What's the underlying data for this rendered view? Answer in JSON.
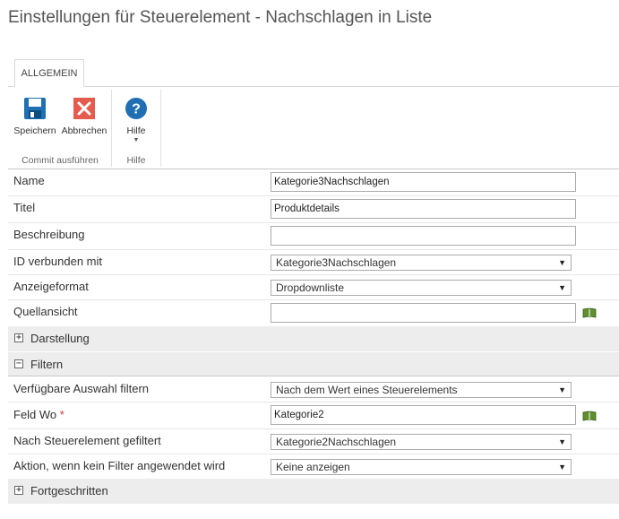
{
  "page": {
    "title": "Einstellungen für Steuerelement - Nachschlagen in Liste"
  },
  "ribbon": {
    "tab_label": "ALLGEMEIN",
    "buttons": {
      "save": "Speichern",
      "cancel": "Abbrechen",
      "help": "Hilfe"
    },
    "groups": {
      "commit": "Commit ausführen",
      "help": "Hilfe"
    }
  },
  "form": {
    "name_label": "Name",
    "name_value": "Kategorie3Nachschlagen",
    "titel_label": "Titel",
    "titel_value": "Produktdetails",
    "beschreibung_label": "Beschreibung",
    "beschreibung_value": "",
    "id_label": "ID verbunden mit",
    "id_value": "Kategorie3Nachschlagen",
    "anzeige_label": "Anzeigeformat",
    "anzeige_value": "Dropdownliste",
    "quelle_label": "Quellansicht",
    "quelle_value": ""
  },
  "sections": {
    "darstellung": "Darstellung",
    "filtern": "Filtern",
    "fortgeschritten": "Fortgeschritten"
  },
  "filter": {
    "auswahl_label": "Verfügbare Auswahl filtern",
    "auswahl_value": "Nach dem Wert eines Steuerelements",
    "feld_label": "Feld Wo",
    "feld_required": "*",
    "feld_value": "Kategorie2",
    "gefiltert_label": "Nach Steuerelement gefiltert",
    "gefiltert_value": "Kategorie2Nachschlagen",
    "aktion_label": "Aktion, wenn kein Filter angewendet wird",
    "aktion_value": "Keine anzeigen"
  },
  "icons": {
    "save": "floppy-disk-icon",
    "cancel": "close-icon",
    "help": "help-icon",
    "picker": "book-icon",
    "expand": "plus-box-icon",
    "collapse": "minus-box-icon"
  },
  "colors": {
    "save_blue": "#1f6fb2",
    "cancel_red": "#e55b4d",
    "help_blue": "#1f6fb2",
    "section_bg": "#ededed"
  }
}
